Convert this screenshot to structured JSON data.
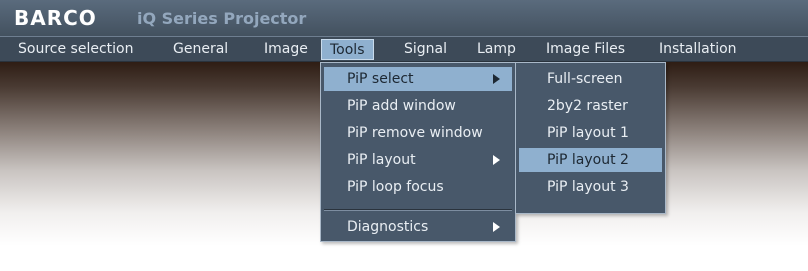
{
  "app": {
    "logo": "BARCO",
    "title": "iQ Series Projector"
  },
  "menubar": {
    "items": [
      {
        "label": "Source selection"
      },
      {
        "label": "General"
      },
      {
        "label": "Image"
      },
      {
        "label": "Tools",
        "active": true
      },
      {
        "label": "Signal"
      },
      {
        "label": "Lamp"
      },
      {
        "label": "Image Files"
      },
      {
        "label": "Installation"
      }
    ]
  },
  "tools_menu": {
    "items": [
      {
        "label": "PiP select",
        "submenu": true,
        "highlighted": true
      },
      {
        "label": "PiP add window"
      },
      {
        "label": "PiP remove window"
      },
      {
        "label": "PiP layout",
        "submenu": true
      },
      {
        "label": "PiP loop focus"
      },
      {
        "label": "Diagnostics",
        "submenu": true
      }
    ]
  },
  "pip_select_submenu": {
    "items": [
      {
        "label": "Full-screen"
      },
      {
        "label": "2by2 raster"
      },
      {
        "label": "PiP layout 1"
      },
      {
        "label": "PiP layout 2",
        "highlighted": true
      },
      {
        "label": "PiP layout 3"
      }
    ]
  },
  "colors": {
    "titlebar": "#4b5a6a",
    "menubar": "#3d4a58",
    "highlight": "#8fb0cf",
    "app_title": "#93a7bd"
  }
}
